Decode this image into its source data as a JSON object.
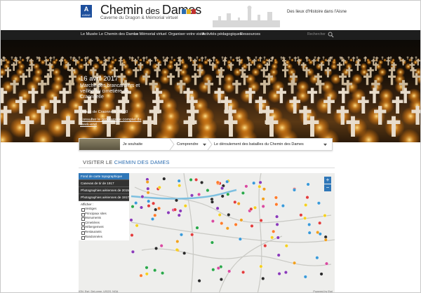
{
  "header": {
    "title_main": "Chemin",
    "title_des": " des ",
    "title_end": "Dames",
    "subtitle": "Caverne du Dragon & Mémorial virtuel",
    "tagline": "Des lieux d'Histoire dans l'Aisne",
    "logo_text": "AISNE",
    "flag_colors": [
      "#2b6cb0",
      "#e0b020",
      "#c03030"
    ]
  },
  "nav": {
    "items": [
      "Le Musée",
      "Le Chemin des Dames",
      "Le Mémorial virtuel",
      "Organiser votre visite",
      "Activités pédagogiques",
      "Ressources"
    ],
    "search_placeholder": "Rechercher"
  },
  "hero": {
    "date": "16 avril 2017",
    "title": "Marche des brancardiers et veillée au cimetière de Craonnelle",
    "depart": "Départ de Craonne à 20h30",
    "link": "Consulter le programme complet du week-end"
  },
  "selector": {
    "first": "Je souhaite",
    "second": "Comprendre",
    "third": "Le déroulement des batailles du Chemin des Dames"
  },
  "section": {
    "prefix": "VISITER LE ",
    "accent": "CHEMIN DES DAMES"
  },
  "map": {
    "layers": [
      "Fond de carte topographique",
      "Canevas de tir de 1917",
      "Photographies aériennes de 2015",
      "Photographies aériennes de 1917"
    ],
    "affiche_label": "Afficher :",
    "affiche_items": [
      "Vestiges",
      "Principaux sites",
      "Monuments",
      "Cimetières",
      "Hébergement",
      "Restaurants",
      "Randonnées"
    ],
    "zoom_in": "+",
    "zoom_out": "−",
    "attribution": "IGN, Esri, DeLorme, USGS, NGA",
    "powered": "Powered by Esri"
  }
}
